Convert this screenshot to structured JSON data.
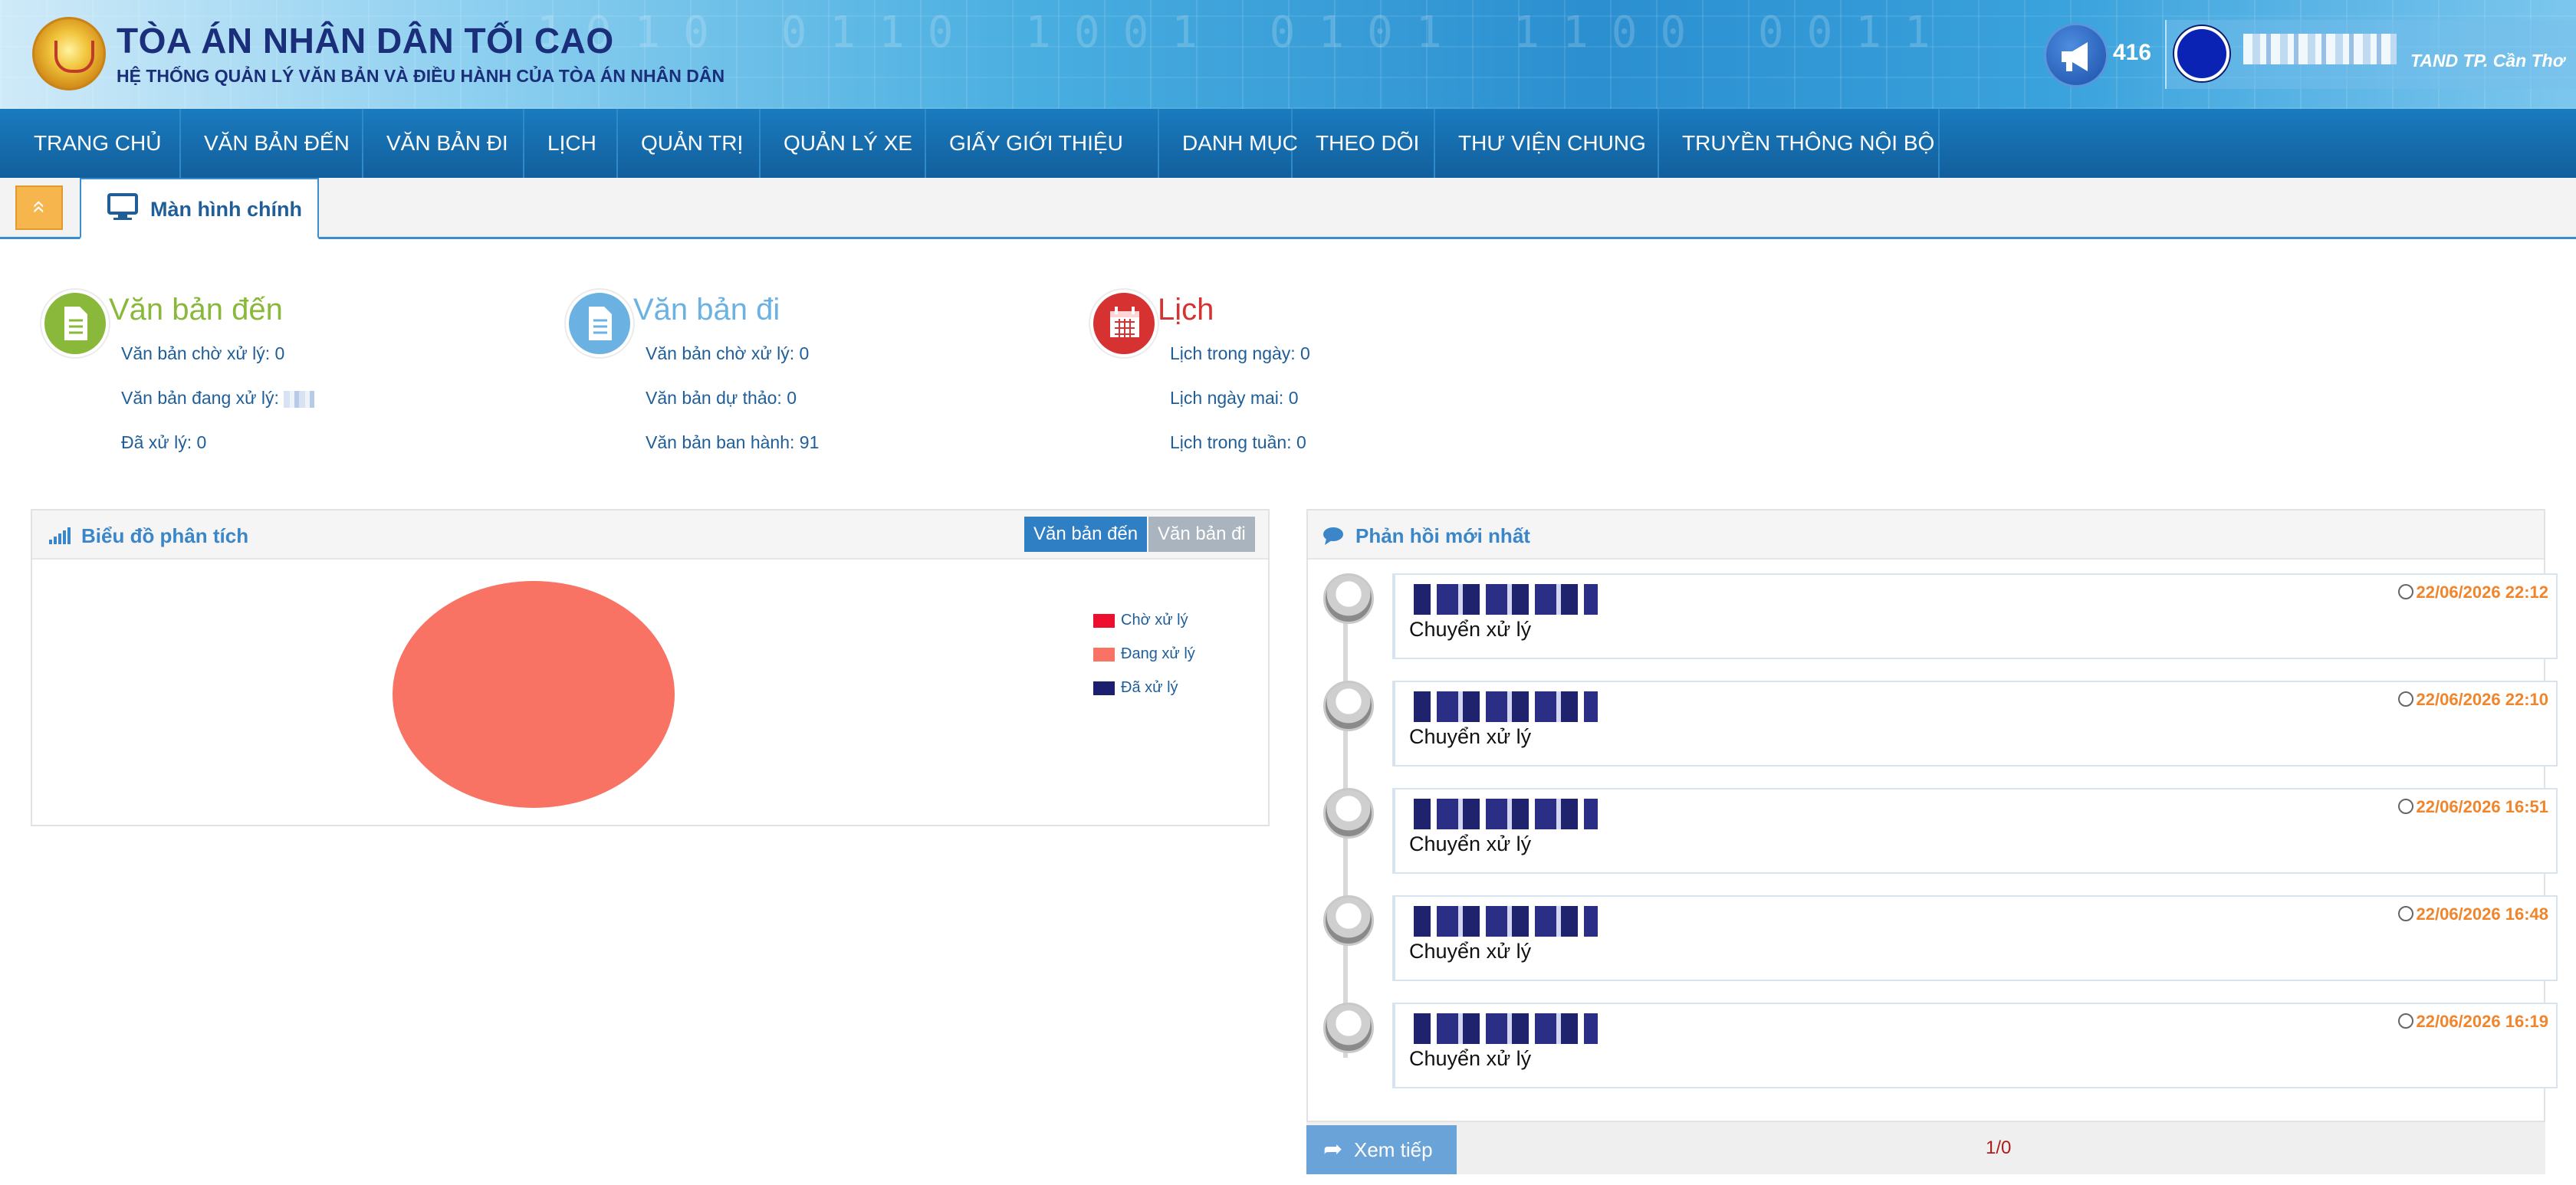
{
  "header": {
    "site_title": "TÒA ÁN NHÂN DÂN TỐI CAO",
    "site_subtitle": "HỆ THỐNG QUẢN LÝ VĂN BẢN VÀ ĐIỀU HÀNH CỦA TÒA ÁN NHÂN DÂN",
    "notification_count": "416",
    "user_unit": "TAND TP. Cần Thơ",
    "icons": {
      "emblem": "court-emblem",
      "notify": "megaphone-icon",
      "avatar": "user-avatar"
    }
  },
  "nav": {
    "items": [
      "TRANG CHỦ",
      "VĂN BẢN ĐẾN",
      "VĂN BẢN ĐI",
      "LỊCH",
      "QUẢN TRỊ",
      "QUẢN LÝ XE",
      "GIẤY GIỚI THIỆU",
      "DANH MỤC",
      "THEO DÕI",
      "THƯ VIỆN CHUNG",
      "TRUYỀN THÔNG NỘI BỘ"
    ]
  },
  "tabs": {
    "collapse_symbol": "«",
    "main_tab": "Màn hình chính"
  },
  "summary": {
    "incoming": {
      "title": "Văn bản đến",
      "color": "#8ab83a",
      "lines": [
        "Văn bản chờ xử lý: 0",
        "Văn bản đang xử lý:",
        "Đã xử lý: 0"
      ]
    },
    "outgoing": {
      "title": "Văn bản đi",
      "color": "#6bb2e3",
      "lines": [
        "Văn bản chờ xử lý: 0",
        "Văn bản dự thảo: 0",
        "Văn bản ban hành: 91"
      ]
    },
    "calendar": {
      "title": "Lịch",
      "color": "#d63232",
      "lines": [
        "Lịch trong ngày: 0",
        "Lịch ngày mai: 0",
        "Lịch trong tuần: 0"
      ]
    }
  },
  "chart_panel": {
    "title": "Biểu đồ phân tích",
    "toggle_incoming": "Văn bản đến",
    "toggle_outgoing": "Văn bản đi"
  },
  "chart_data": {
    "type": "pie",
    "categories": [
      "Chờ xử lý",
      "Đang xử lý",
      "Đã xử lý"
    ],
    "values": [
      0,
      1,
      0
    ],
    "colors": [
      "#ee0f2e",
      "#f87363",
      "#1b1f6e"
    ],
    "legend": "right"
  },
  "feedback": {
    "title": "Phản hồi mới nhất",
    "items": [
      {
        "text": "Chuyển xử lý",
        "time": "22/06/2026 22:12"
      },
      {
        "text": "Chuyển xử lý",
        "time": "22/06/2026 22:10"
      },
      {
        "text": "Chuyển xử lý",
        "time": "22/06/2026 16:51"
      },
      {
        "text": "Chuyển xử lý",
        "time": "22/06/2026 16:48"
      },
      {
        "text": "Chuyển xử lý",
        "time": "22/06/2026 16:19"
      }
    ],
    "more_label": "Xem tiếp",
    "pager": "1/0"
  }
}
